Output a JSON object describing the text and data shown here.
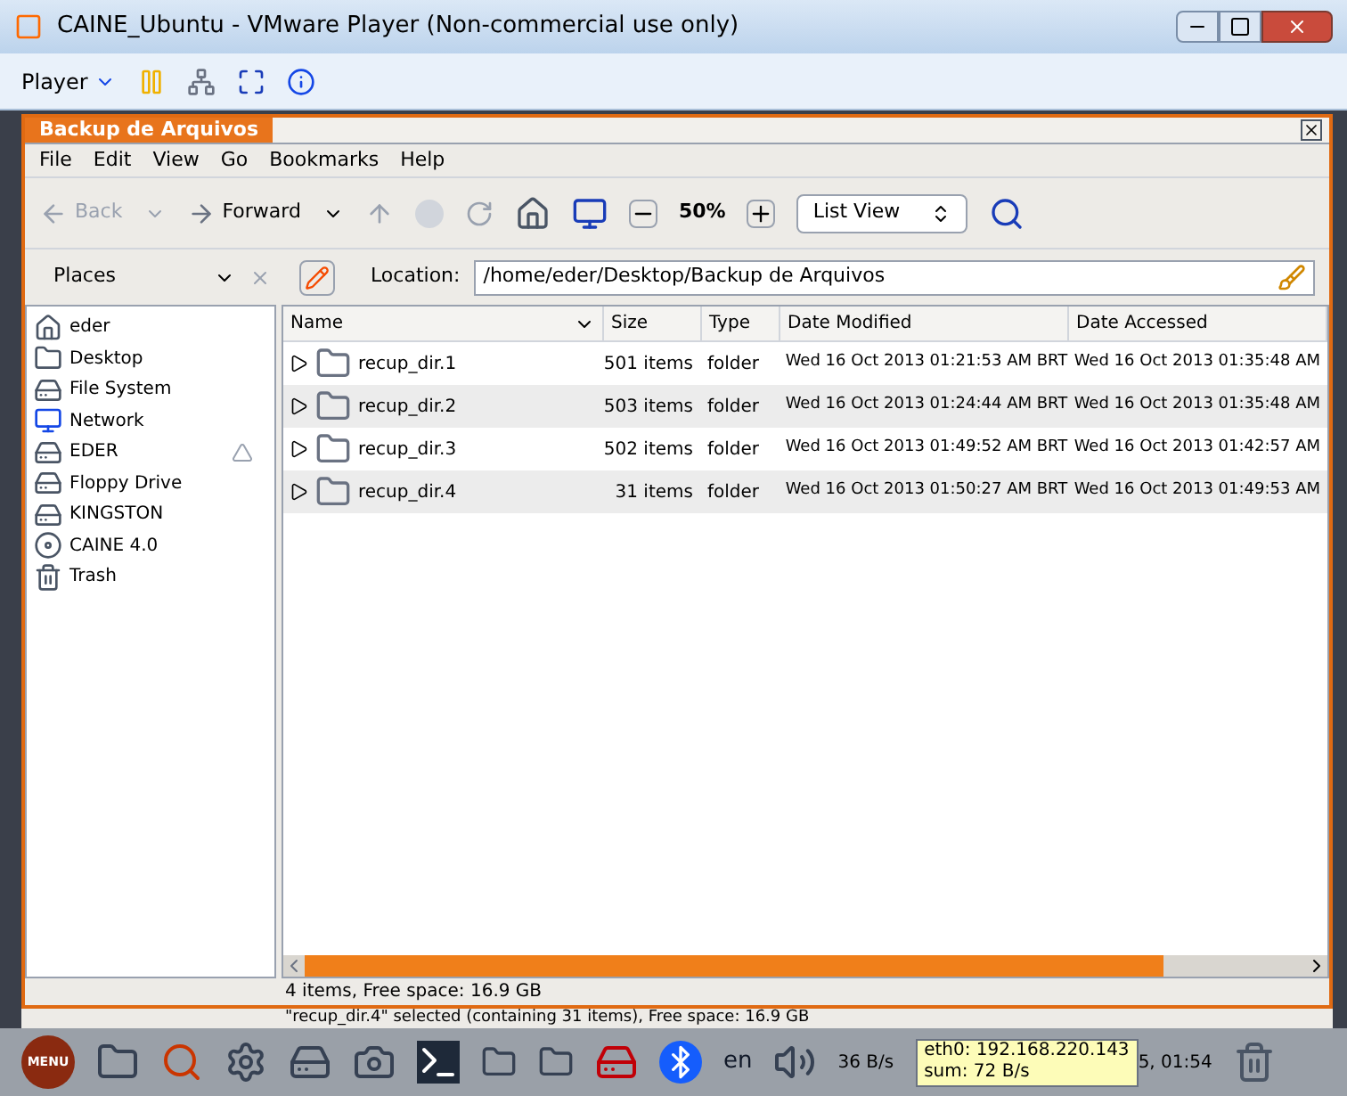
{
  "window": {
    "title": "CAINE_Ubuntu - VMware Player (Non-commercial use only)"
  },
  "player_toolbar": {
    "menu": "Player"
  },
  "file_manager": {
    "title": "Backup de Arquivos",
    "menu": [
      "File",
      "Edit",
      "View",
      "Go",
      "Bookmarks",
      "Help"
    ],
    "toolbar": {
      "back": "Back",
      "forward": "Forward",
      "zoom": "50%",
      "view": "List View"
    },
    "places": {
      "label": "Places"
    },
    "location": {
      "label": "Location:",
      "value": "/home/eder/Desktop/Backup de Arquivos"
    },
    "sidebar": {
      "items": [
        {
          "label": "eder",
          "kind": "home",
          "ejectable": false
        },
        {
          "label": "Desktop",
          "kind": "desktop",
          "ejectable": false
        },
        {
          "label": "File System",
          "kind": "filesystem",
          "ejectable": false
        },
        {
          "label": "Network",
          "kind": "network",
          "ejectable": false
        },
        {
          "label": "EDER",
          "kind": "drive",
          "ejectable": true
        },
        {
          "label": "Floppy Drive",
          "kind": "drive",
          "ejectable": false
        },
        {
          "label": "KINGSTON",
          "kind": "drive",
          "ejectable": false
        },
        {
          "label": "CAINE 4.0",
          "kind": "cdrom",
          "ejectable": false
        },
        {
          "label": "Trash",
          "kind": "trash",
          "ejectable": false
        }
      ]
    },
    "table": {
      "columns": [
        "Name",
        "Size",
        "Type",
        "Date Modified",
        "Date Accessed"
      ],
      "rows": [
        {
          "name": "recup_dir.1",
          "size": "501 items",
          "type": "folder",
          "modified": "Wed 16 Oct 2013 01:21:53 AM BRT",
          "accessed": "Wed 16 Oct 2013 01:35:48 AM"
        },
        {
          "name": "recup_dir.2",
          "size": "503 items",
          "type": "folder",
          "modified": "Wed 16 Oct 2013 01:24:44 AM BRT",
          "accessed": "Wed 16 Oct 2013 01:35:48 AM"
        },
        {
          "name": "recup_dir.3",
          "size": "502 items",
          "type": "folder",
          "modified": "Wed 16 Oct 2013 01:49:52 AM BRT",
          "accessed": "Wed 16 Oct 2013 01:42:57 AM"
        },
        {
          "name": "recup_dir.4",
          "size": "31 items",
          "type": "folder",
          "modified": "Wed 16 Oct 2013 01:50:27 AM BRT",
          "accessed": "Wed 16 Oct 2013 01:49:53 AM"
        }
      ]
    },
    "status_bar": "4 items, Free space: 16.9 GB"
  },
  "background_status": "\"recup_dir.4\" selected (containing 31 items), Free space: 16.9 GB",
  "taskbar": {
    "menu": "MENU",
    "language": "en",
    "net_speed": "36 B/s",
    "tooltip": [
      "eth0: 192.168.220.143",
      "sum: 72 B/s"
    ],
    "clock": "5, 01:54"
  }
}
